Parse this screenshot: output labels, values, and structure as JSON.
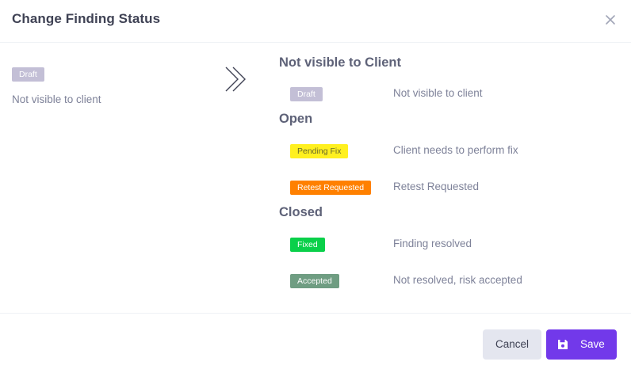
{
  "dialog": {
    "title": "Change Finding Status",
    "close_icon": "close-icon"
  },
  "current": {
    "badge": {
      "label": "Draft",
      "bg": "#c3bfd6",
      "fg": "#ffffff"
    },
    "description": "Not visible to client"
  },
  "arrow_icon": "double-chevron-right-icon",
  "groups": [
    {
      "title": "Not visible to Client",
      "statuses": [
        {
          "badge": "Draft",
          "bg": "#c3bfd6",
          "fg": "#ffffff",
          "description": "Not visible to client"
        }
      ]
    },
    {
      "title": "Open",
      "statuses": [
        {
          "badge": "Pending Fix",
          "bg": "#fff01f",
          "fg": "#6b6b2a",
          "description": "Client needs to perform fix"
        },
        {
          "badge": "Retest Requested",
          "bg": "#ff8000",
          "fg": "#ffffff",
          "description": "Retest Requested"
        }
      ]
    },
    {
      "title": "Closed",
      "statuses": [
        {
          "badge": "Fixed",
          "bg": "#0ad04a",
          "fg": "#ffffff",
          "description": "Finding resolved"
        },
        {
          "badge": "Accepted",
          "bg": "#6f9d82",
          "fg": "#ffffff",
          "description": "Not resolved, risk accepted"
        }
      ]
    }
  ],
  "footer": {
    "cancel_label": "Cancel",
    "save_label": "Save",
    "save_icon": "save-icon",
    "accent": "#7239ea"
  }
}
